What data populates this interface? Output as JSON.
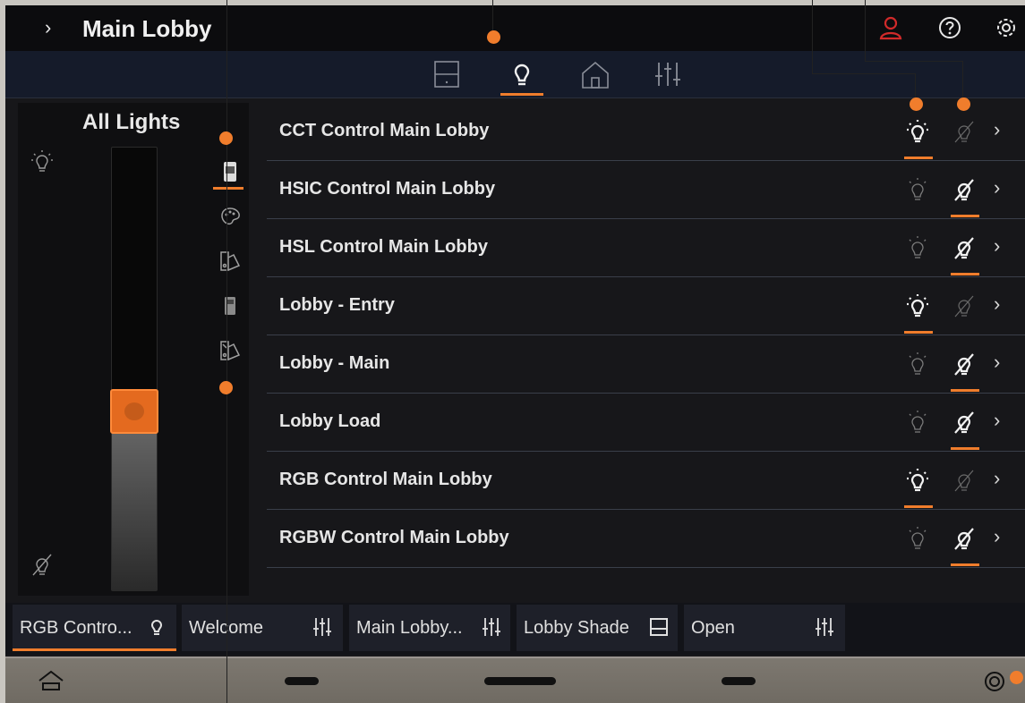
{
  "header": {
    "chevron": "›",
    "title": "Main Lobby",
    "icons": [
      "user-alert-icon",
      "help-icon",
      "settings-icon"
    ],
    "alert_color": "#d12a2a"
  },
  "tabs": [
    "shade-tab",
    "lights-tab",
    "home-tab",
    "controls-tab"
  ],
  "active_tab": "lights",
  "left_panel": {
    "title": "All Lights",
    "level_percent": 40,
    "mode_icons": [
      "fixture-mode-icon",
      "palette-mode-icon",
      "color-swatch-mode-icon",
      "device-mode-icon",
      "color-swatch-alt-mode-icon"
    ]
  },
  "loads": [
    {
      "label": "CCT Control Main Lobby",
      "state": "on"
    },
    {
      "label": "HSIC Control Main Lobby",
      "state": "off"
    },
    {
      "label": "HSL Control Main Lobby",
      "state": "off"
    },
    {
      "label": "Lobby - Entry",
      "state": "on"
    },
    {
      "label": "Lobby - Main",
      "state": "off"
    },
    {
      "label": "Lobby Load",
      "state": "off"
    },
    {
      "label": "RGB Control Main Lobby",
      "state": "on"
    },
    {
      "label": "RGBW Control Main Lobby",
      "state": "off"
    }
  ],
  "row_arrow": "›",
  "scenes": [
    {
      "label": "RGB Contro...",
      "icon": "bulb-icon",
      "active": true
    },
    {
      "label": "Welcome",
      "icon": "sliders-icon",
      "active": false
    },
    {
      "label": "Main Lobby...",
      "icon": "sliders-icon",
      "active": false
    },
    {
      "label": "Lobby Shade",
      "icon": "shade-icon",
      "active": false
    },
    {
      "label": "Open",
      "icon": "sliders-icon",
      "active": false
    }
  ],
  "accent_color": "#f07d2c"
}
